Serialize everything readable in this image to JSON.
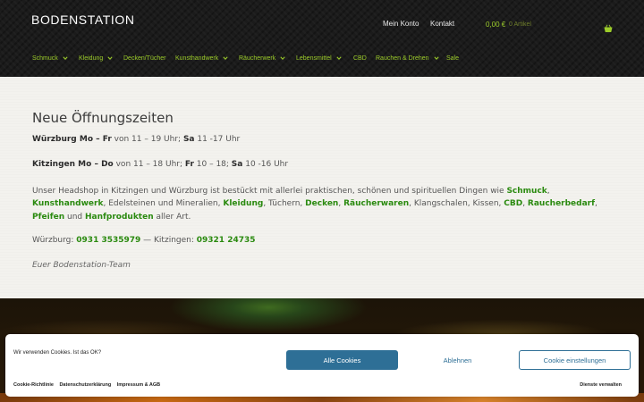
{
  "header": {
    "logo": "BODENSTATION",
    "top_links": [
      "Mein Konto",
      "Kontakt"
    ],
    "cart": {
      "total": "0,00 €",
      "count": "0 Artikel",
      "icon": "basket-icon"
    },
    "nav": [
      {
        "label": "Schmuck",
        "has_dropdown": true
      },
      {
        "label": "Kleidung",
        "has_dropdown": true
      },
      {
        "label": "Decken/Tücher",
        "has_dropdown": false
      },
      {
        "label": "Kunsthandwerk",
        "has_dropdown": true
      },
      {
        "label": "Räucherwerk",
        "has_dropdown": true
      },
      {
        "label": "Lebensmittel",
        "has_dropdown": true
      },
      {
        "label": "CBD",
        "has_dropdown": false
      },
      {
        "label": "Rauchen & Drehen",
        "has_dropdown": true
      },
      {
        "label": "Sale",
        "has_dropdown": false
      }
    ],
    "accent_color": "#9ccc2a"
  },
  "content": {
    "title": "Neue Öffnungszeiten",
    "wuerzburg": {
      "label": "Würzburg Mo – Fr",
      "t1": " von 11 – 19 Uhr; ",
      "sa": "Sa",
      "t2": " 11 -17 Uhr"
    },
    "kitzingen": {
      "label": "Kitzingen Mo – Do",
      "t1": " von 11 – 18 Uhr; ",
      "fr": "Fr",
      "t2": " 10 – 18; ",
      "sa": "Sa",
      "t3": " 10 -16 Uhr"
    },
    "paragraph": {
      "p1": "Unser Headshop in Kitzingen und Würzburg ist bestückt mit allerlei praktischen, schönen und spirituellen Dingen wie ",
      "link_schmuck": "Schmuck",
      "c1": ", ",
      "link_kunsthandwerk": "Kunsthandwerk",
      "p2": ", Edelsteinen und Mineralien, ",
      "link_kleidung": "Kleidung",
      "p3": ", Tüchern, ",
      "link_decken": "Decken",
      "c2": ", ",
      "link_raeucherwaren": "Räucherwaren",
      "p4": ", Klangschalen, Kissen, ",
      "link_cbd": "CBD",
      "c3": ", ",
      "link_raucherbedarf": "Raucherbedarf",
      "c4": ", ",
      "link_pfeifen": "Pfeifen",
      "p5": " und ",
      "link_hanf": "Hanfprodukten",
      "p6": " aller Art."
    },
    "phones": {
      "wuerzburg_label": "Würzburg: ",
      "wuerzburg_phone": "0931 3535979",
      "sep": " — Kitzingen: ",
      "kitzingen_phone": "09321 24735"
    },
    "signature": "Euer Bodenstation-Team",
    "link_color": "#2a8a0f"
  },
  "cookie_banner": {
    "message": "Wir verwenden Cookies. Ist das OK?",
    "accept": "Alle Cookies",
    "deny": "Ablehnen",
    "settings": "Cookie einstellungen",
    "links": [
      "Cookie-Richtlinie",
      "Datenschutzerklärung",
      "Impressum & AGB"
    ],
    "services": "Dienste verwalten",
    "button_color": "#2e6f96"
  }
}
